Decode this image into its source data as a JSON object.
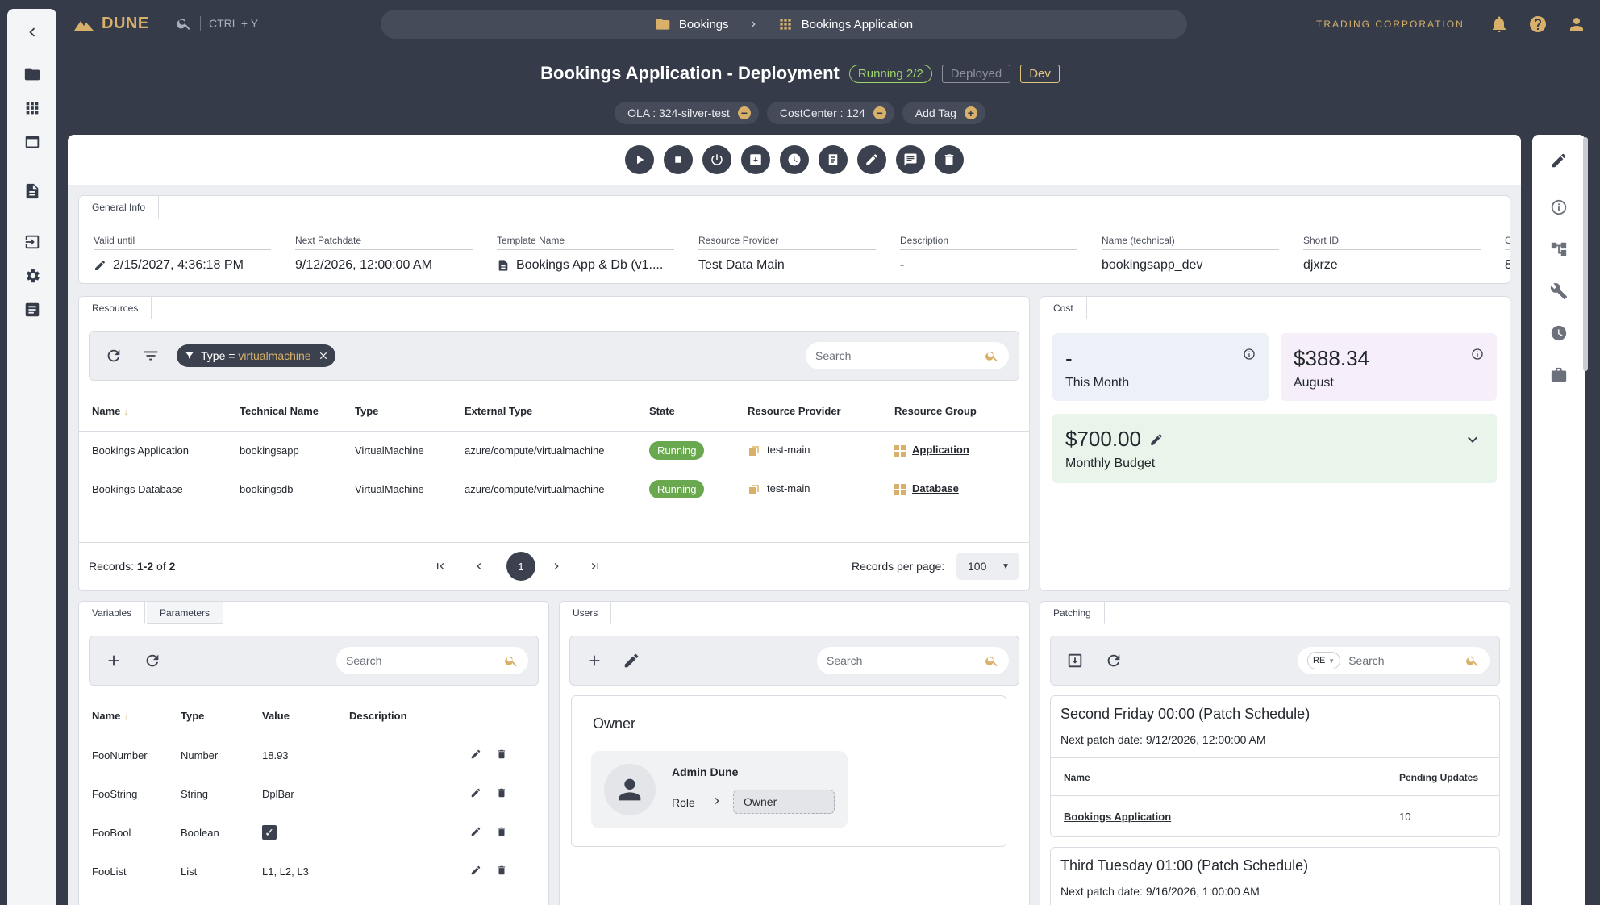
{
  "app": {
    "name": "DUNE",
    "search_shortcut": "CTRL + Y",
    "organization": "TRADING CORPORATION"
  },
  "breadcrumb": {
    "items": [
      "Bookings",
      "Bookings Application"
    ]
  },
  "header": {
    "title": "Bookings Application - Deployment",
    "status_running": "Running 2/2",
    "status_deployed": "Deployed",
    "environment": "Dev"
  },
  "tags": {
    "items": [
      "OLA : 324-silver-test",
      "CostCenter : 124"
    ],
    "add_label": "Add Tag"
  },
  "general_info": {
    "tab": "General Info",
    "fields": [
      {
        "label": "Valid until",
        "value": "2/15/2027, 4:36:18 PM"
      },
      {
        "label": "Next Patchdate",
        "value": "9/12/2026, 12:00:00 AM"
      },
      {
        "label": "Template Name",
        "value": "Bookings App & Db (v1...."
      },
      {
        "label": "Resource Provider",
        "value": "Test Data Main"
      },
      {
        "label": "Description",
        "value": "-"
      },
      {
        "label": "Name (technical)",
        "value": "bookingsapp_dev"
      },
      {
        "label": "Short ID",
        "value": "djxrze"
      },
      {
        "label": "C",
        "value": "8"
      }
    ]
  },
  "resources": {
    "tab": "Resources",
    "search_placeholder": "Search",
    "filter": {
      "key": "Type",
      "op": "=",
      "value": "virtualmachine"
    },
    "columns": [
      "Name",
      "Technical Name",
      "Type",
      "External Type",
      "State",
      "Resource Provider",
      "Resource Group"
    ],
    "rows": [
      {
        "name": "Bookings Application",
        "technical": "bookingsapp",
        "type": "VirtualMachine",
        "external": "azure/compute/virtualmachine",
        "state": "Running",
        "provider": "test-main",
        "group": "Application"
      },
      {
        "name": "Bookings Database",
        "technical": "bookingsdb",
        "type": "VirtualMachine",
        "external": "azure/compute/virtualmachine",
        "state": "Running",
        "provider": "test-main",
        "group": "Database"
      }
    ],
    "records_prefix": "Records: ",
    "records_range": "1-2",
    "records_of": " of ",
    "records_total": "2",
    "current_page": "1",
    "per_page_label": "Records per page:",
    "per_page": "100"
  },
  "cost": {
    "tab": "Cost",
    "this_month_value": "-",
    "this_month_label": "This Month",
    "august_value": "$388.34",
    "august_label": "August",
    "budget_value": "$700.00",
    "budget_label": "Monthly Budget"
  },
  "variables": {
    "tabs": [
      "Variables",
      "Parameters"
    ],
    "search_placeholder": "Search",
    "columns": [
      "Name",
      "Type",
      "Value",
      "Description"
    ],
    "rows": [
      {
        "name": "FooNumber",
        "type": "Number",
        "value": "18.93"
      },
      {
        "name": "FooString",
        "type": "String",
        "value": "DplBar"
      },
      {
        "name": "FooBool",
        "type": "Boolean",
        "value": ""
      },
      {
        "name": "FooList",
        "type": "List",
        "value": "L1, L2, L3"
      }
    ]
  },
  "users": {
    "tab": "Users",
    "search_placeholder": "Search",
    "group": "Owner",
    "user_name": "Admin Dune",
    "role_label": "Role",
    "role_value": "Owner"
  },
  "patching": {
    "tab": "Patching",
    "search_placeholder": "Search",
    "re_chip": "RE",
    "schedules": [
      {
        "title": "Second Friday 00:00 (Patch Schedule)",
        "next_label": "Next patch date: ",
        "next_value": "9/12/2026, 12:00:00 AM"
      },
      {
        "title": "Third Tuesday 01:00 (Patch Schedule)",
        "next_label": "Next patch date: ",
        "next_value": "9/16/2026, 1:00:00 AM"
      }
    ],
    "col_name": "Name",
    "col_pending": "Pending Updates",
    "row_name": "Bookings Application",
    "row_pending": "10"
  },
  "colors": {
    "accent": "#d8b06a",
    "dark": "#353b49",
    "running": "#6aa84f"
  }
}
